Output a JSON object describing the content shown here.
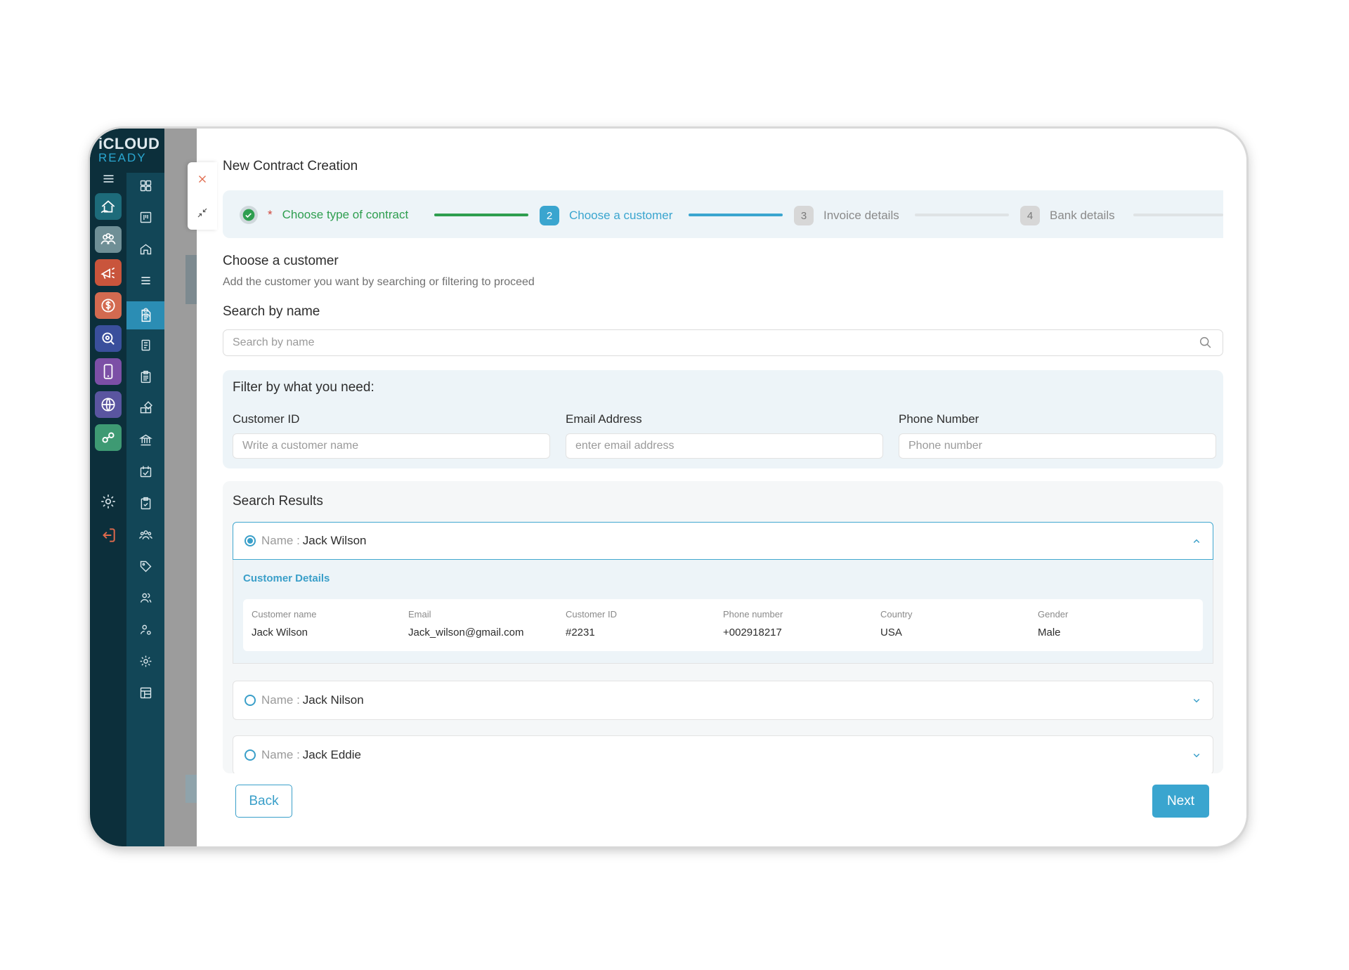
{
  "logo": {
    "line1": "iCLOUD",
    "line2": "READY"
  },
  "page": {
    "title": "New Contract Creation"
  },
  "stepper": {
    "steps": [
      {
        "num": "✓",
        "label": "Choose type of contract",
        "required": "*",
        "state": "done"
      },
      {
        "num": "2",
        "label": "Choose a customer",
        "state": "active"
      },
      {
        "num": "3",
        "label": "Invoice details",
        "state": "pending"
      },
      {
        "num": "4",
        "label": "Bank details",
        "state": "pending"
      }
    ]
  },
  "customer_section": {
    "title": "Choose a customer",
    "subtitle": "Add the customer you want by searching or filtering to proceed"
  },
  "search": {
    "label": "Search by name",
    "placeholder": "Search by name"
  },
  "filter": {
    "title": "Filter by what you need:",
    "fields": [
      {
        "label": "Customer ID",
        "placeholder": "Write a customer name"
      },
      {
        "label": "Email Address",
        "placeholder": "enter email address"
      },
      {
        "label": "Phone Number",
        "placeholder": "Phone number"
      }
    ]
  },
  "results": {
    "title": "Search Results",
    "name_key": "Name :",
    "items": [
      {
        "name": "Jack Wilson",
        "selected": true,
        "expanded": true
      },
      {
        "name": "Jack Nilson",
        "selected": false,
        "expanded": false
      },
      {
        "name": "Jack Eddie",
        "selected": false,
        "expanded": false
      }
    ],
    "details": {
      "title": "Customer Details",
      "columns": [
        {
          "key": "Customer name",
          "value": "Jack Wilson"
        },
        {
          "key": "Email",
          "value": "Jack_wilson@gmail.com"
        },
        {
          "key": "Customer ID",
          "value": "#2231"
        },
        {
          "key": "Phone number",
          "value": "+002918217"
        },
        {
          "key": "Country",
          "value": "USA"
        },
        {
          "key": "Gender",
          "value": "Male"
        }
      ]
    }
  },
  "buttons": {
    "back": "Back",
    "next": "Next"
  },
  "colors": {
    "accent": "#3aa5cf",
    "success": "#2e9e4f",
    "sidebar_dark": "#0c2f3b",
    "sidebar": "#124657"
  },
  "sidebar_apps": [
    "real-estate-icon",
    "team-icon",
    "marketing-icon",
    "finance-icon",
    "search-icon",
    "mobile-icon",
    "globe-icon",
    "link-icon"
  ],
  "sidebar_nav": [
    "dashboard-icon",
    "kanban-icon",
    "home-icon",
    "menu-icon",
    "user-icon",
    "contract-icon",
    "document-icon",
    "clipboard-icon",
    "modules-icon",
    "bank-icon",
    "calendar-check-icon",
    "task-icon",
    "group-icon",
    "tag-icon",
    "users-icon",
    "user-settings-icon",
    "settings-icon",
    "layout-icon"
  ]
}
